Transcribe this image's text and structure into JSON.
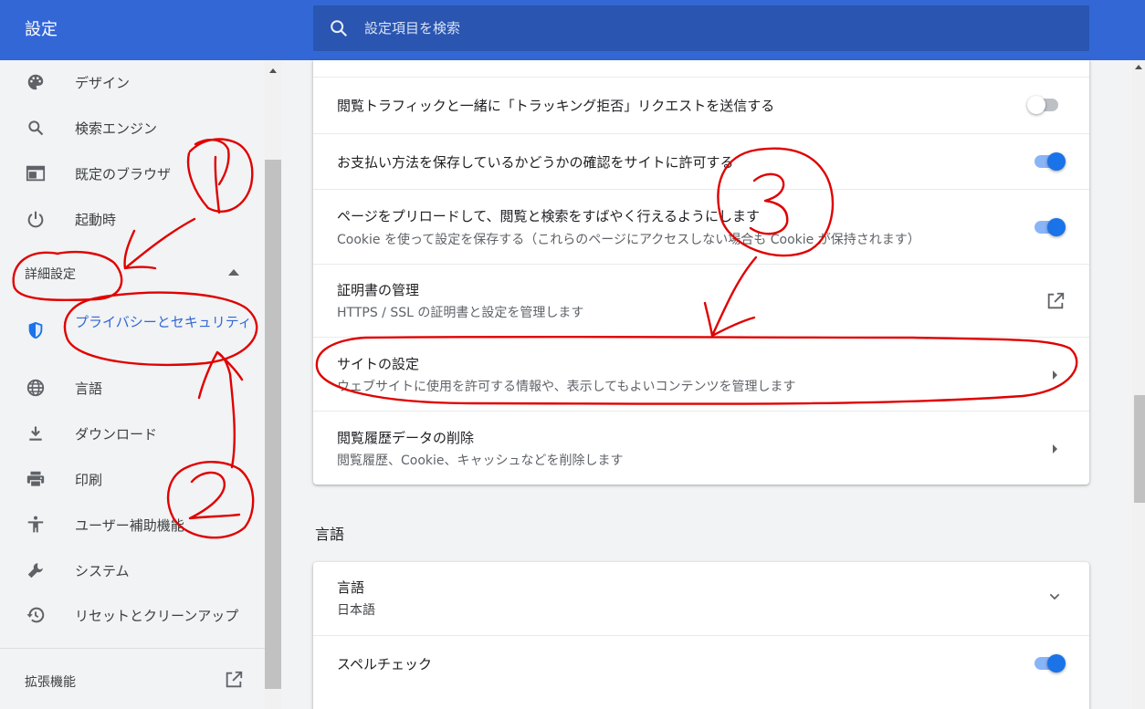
{
  "header": {
    "title": "設定",
    "search_placeholder": "設定項目を検索"
  },
  "sidebar": {
    "items": [
      {
        "label": "デザイン",
        "icon": "palette-icon"
      },
      {
        "label": "検索エンジン",
        "icon": "search-icon"
      },
      {
        "label": "既定のブラウザ",
        "icon": "browser-icon"
      },
      {
        "label": "起動時",
        "icon": "power-icon"
      }
    ],
    "advanced_label": "詳細設定",
    "advanced_items": [
      {
        "label": "プライバシーとセキュリティ",
        "icon": "shield-icon",
        "active": true
      },
      {
        "label": "言語",
        "icon": "globe-icon"
      },
      {
        "label": "ダウンロード",
        "icon": "download-icon"
      },
      {
        "label": "印刷",
        "icon": "printer-icon"
      },
      {
        "label": "ユーザー補助機能",
        "icon": "accessibility-icon"
      },
      {
        "label": "システム",
        "icon": "wrench-icon"
      },
      {
        "label": "リセットとクリーンアップ",
        "icon": "history-icon"
      }
    ],
    "extensions_label": "拡張機能"
  },
  "privacy_card": {
    "rows": [
      {
        "title": "閲覧トラフィックと一緒に「トラッキング拒否」リクエストを送信する",
        "toggle": false
      },
      {
        "title": "お支払い方法を保存しているかどうかの確認をサイトに許可する",
        "toggle": true
      },
      {
        "title": "ページをプリロードして、閲覧と検索をすばやく行えるようにします",
        "subtitle": "Cookie を使って設定を保存する（これらのページにアクセスしない場合も Cookie が保持されます）",
        "toggle": true
      },
      {
        "title": "証明書の管理",
        "subtitle": "HTTPS / SSL の証明書と設定を管理します"
      },
      {
        "title": "サイトの設定",
        "subtitle": "ウェブサイトに使用を許可する情報や、表示してもよいコンテンツを管理します"
      },
      {
        "title": "閲覧履歴データの削除",
        "subtitle": "閲覧履歴、Cookie、キャッシュなどを削除します"
      }
    ]
  },
  "language_section": {
    "heading": "言語",
    "rows": [
      {
        "title": "言語",
        "subtitle": "日本語"
      },
      {
        "title": "スペルチェック",
        "toggle": true
      }
    ]
  },
  "annotations": [
    "1",
    "2",
    "3"
  ],
  "colors": {
    "accent": "#3367d6",
    "toggle_on": "#1a73e8",
    "annotation": "#e00000"
  }
}
